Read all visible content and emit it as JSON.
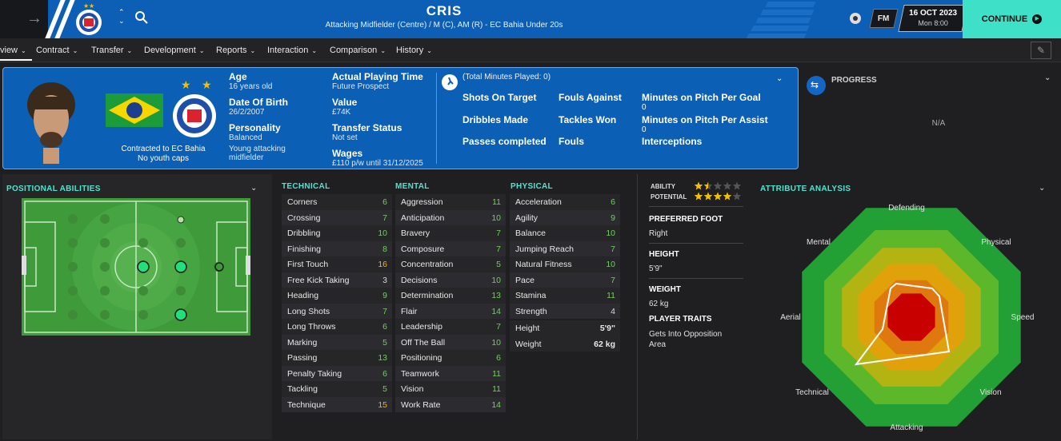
{
  "header": {
    "player_name": "CRIS",
    "subtitle": "Attacking Midfielder (Centre) / M (C), AM (R) - EC Bahia Under 20s",
    "fm_label": "FM",
    "date": "16 OCT 2023",
    "time": "Mon 8:00",
    "continue_label": "CONTINUE"
  },
  "tabs": [
    {
      "label": "view"
    },
    {
      "label": "Contract"
    },
    {
      "label": "Transfer"
    },
    {
      "label": "Development"
    },
    {
      "label": "Reports"
    },
    {
      "label": "Interaction"
    },
    {
      "label": "Comparison"
    },
    {
      "label": "History"
    }
  ],
  "profile": {
    "contract_line1": "Contracted to EC Bahia",
    "contract_line2": "No youth caps",
    "age_label": "Age",
    "age_value": "16 years old",
    "dob_label": "Date Of Birth",
    "dob_value": "26/2/2007",
    "personality_label": "Personality",
    "personality_value": "Balanced",
    "media_line1": "Young attacking",
    "media_line2": "midfielder",
    "playing_time_label": "Actual Playing Time",
    "playing_time_value": "Future Prospect",
    "value_label": "Value",
    "value_value": "£74K",
    "transfer_label": "Transfer Status",
    "transfer_value": "Not set",
    "wages_label": "Wages",
    "wages_value": "£110 p/w until 31/12/2025"
  },
  "stats": {
    "minutes_note": "(Total Minutes Played: 0)",
    "col1": [
      "Shots On Target",
      "Dribbles Made",
      "Passes completed"
    ],
    "col2": [
      "Fouls Against",
      "Tackles Won",
      "Fouls"
    ],
    "col3": [
      {
        "label": "Minutes on Pitch Per Goal",
        "value": "0"
      },
      {
        "label": "Minutes on Pitch Per Assist",
        "value": "0"
      },
      {
        "label": "Interceptions",
        "value": ""
      }
    ]
  },
  "progress": {
    "title": "PROGRESS",
    "value": "N/A"
  },
  "positional": {
    "title": "POSITIONAL ABILITIES"
  },
  "technical": {
    "title": "TECHNICAL",
    "rows": [
      {
        "name": "Corners",
        "value": "6",
        "tone": "green"
      },
      {
        "name": "Crossing",
        "value": "7",
        "tone": "green"
      },
      {
        "name": "Dribbling",
        "value": "10",
        "tone": "green"
      },
      {
        "name": "Finishing",
        "value": "8",
        "tone": "green"
      },
      {
        "name": "First Touch",
        "value": "16",
        "tone": "orange"
      },
      {
        "name": "Free Kick Taking",
        "value": "3",
        "tone": "gray"
      },
      {
        "name": "Heading",
        "value": "9",
        "tone": "green"
      },
      {
        "name": "Long Shots",
        "value": "7",
        "tone": "green"
      },
      {
        "name": "Long Throws",
        "value": "6",
        "tone": "green"
      },
      {
        "name": "Marking",
        "value": "5",
        "tone": "green"
      },
      {
        "name": "Passing",
        "value": "13",
        "tone": "green"
      },
      {
        "name": "Penalty Taking",
        "value": "6",
        "tone": "green"
      },
      {
        "name": "Tackling",
        "value": "5",
        "tone": "green"
      },
      {
        "name": "Technique",
        "value": "15",
        "tone": "orange"
      }
    ]
  },
  "mental": {
    "title": "MENTAL",
    "rows": [
      {
        "name": "Aggression",
        "value": "11",
        "tone": "green"
      },
      {
        "name": "Anticipation",
        "value": "10",
        "tone": "green"
      },
      {
        "name": "Bravery",
        "value": "7",
        "tone": "green"
      },
      {
        "name": "Composure",
        "value": "7",
        "tone": "green"
      },
      {
        "name": "Concentration",
        "value": "5",
        "tone": "green"
      },
      {
        "name": "Decisions",
        "value": "10",
        "tone": "green"
      },
      {
        "name": "Determination",
        "value": "13",
        "tone": "green"
      },
      {
        "name": "Flair",
        "value": "14",
        "tone": "green"
      },
      {
        "name": "Leadership",
        "value": "7",
        "tone": "green"
      },
      {
        "name": "Off The Ball",
        "value": "10",
        "tone": "green"
      },
      {
        "name": "Positioning",
        "value": "6",
        "tone": "green"
      },
      {
        "name": "Teamwork",
        "value": "11",
        "tone": "green"
      },
      {
        "name": "Vision",
        "value": "11",
        "tone": "green"
      },
      {
        "name": "Work Rate",
        "value": "14",
        "tone": "green"
      }
    ]
  },
  "physical": {
    "title": "PHYSICAL",
    "rows": [
      {
        "name": "Acceleration",
        "value": "6",
        "tone": "green"
      },
      {
        "name": "Agility",
        "value": "9",
        "tone": "green"
      },
      {
        "name": "Balance",
        "value": "10",
        "tone": "green"
      },
      {
        "name": "Jumping Reach",
        "value": "7",
        "tone": "green"
      },
      {
        "name": "Natural Fitness",
        "value": "10",
        "tone": "green"
      },
      {
        "name": "Pace",
        "value": "7",
        "tone": "green"
      },
      {
        "name": "Stamina",
        "value": "11",
        "tone": "green"
      },
      {
        "name": "Strength",
        "value": "4",
        "tone": "gray"
      }
    ],
    "height_label": "Height",
    "height_value": "5'9\"",
    "weight_label": "Weight",
    "weight_value": "62 kg"
  },
  "side": {
    "ability_label": "ABILITY",
    "ability_stars": 1.5,
    "potential_label": "POTENTIAL",
    "potential_stars": 4,
    "foot_label": "PREFERRED FOOT",
    "foot_value": "Right",
    "height_label": "HEIGHT",
    "height_value": "5'9\"",
    "weight_label": "WEIGHT",
    "weight_value": "62 kg",
    "traits_label": "PLAYER TRAITS",
    "traits_line1": "Gets Into Opposition",
    "traits_line2": "Area"
  },
  "analysis": {
    "title": "ATTRIBUTE ANALYSIS",
    "axes": [
      "Defending",
      "Physical",
      "Speed",
      "Vision",
      "Attacking",
      "Technical",
      "Aerial",
      "Mental"
    ]
  },
  "colors": {
    "accent": "#4fe3cf",
    "header_blue": "#0d5fb5",
    "attr_green": "#6fd05a",
    "attr_orange": "#f2b21c",
    "star_gold": "#f2c200"
  }
}
